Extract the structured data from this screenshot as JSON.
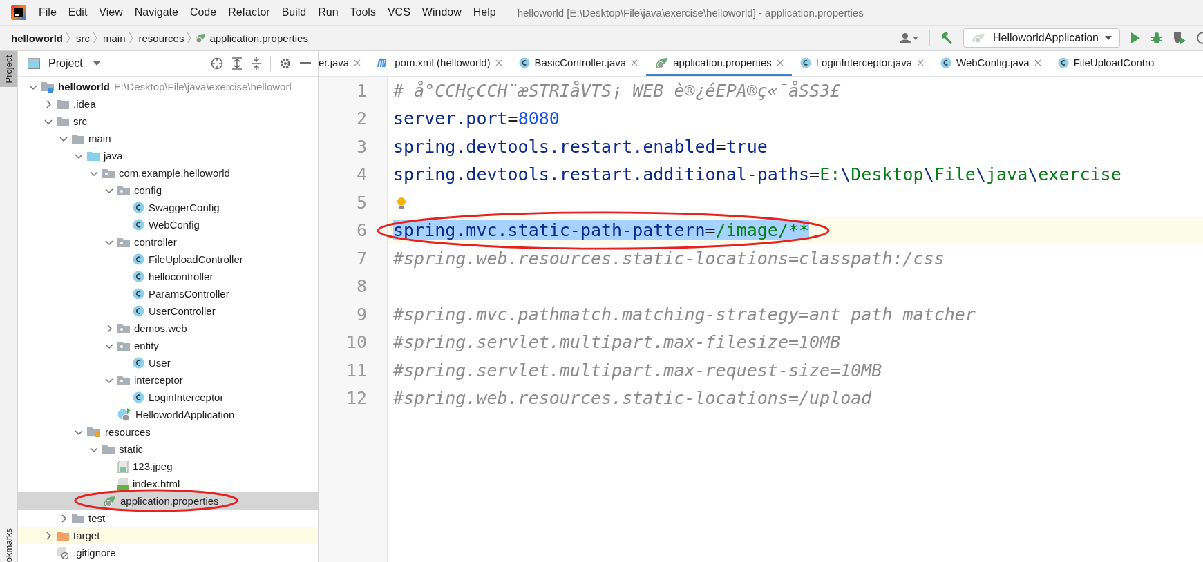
{
  "window": {
    "title": "helloworld [E:\\Desktop\\File\\java\\exercise\\helloworld] - application.properties"
  },
  "menu": [
    "File",
    "Edit",
    "View",
    "Navigate",
    "Code",
    "Refactor",
    "Build",
    "Run",
    "Tools",
    "VCS",
    "Window",
    "Help"
  ],
  "breadcrumbs": [
    {
      "label": "helloworld",
      "kind": "project"
    },
    {
      "label": "src",
      "kind": "folder"
    },
    {
      "label": "main",
      "kind": "folder"
    },
    {
      "label": "resources",
      "kind": "folder"
    },
    {
      "label": "application.properties",
      "kind": "properties"
    }
  ],
  "run_config": "HelloworldApplication",
  "side_stripe": [
    {
      "label": "Project",
      "selected": true
    },
    {
      "label": "okmarks",
      "selected": false
    }
  ],
  "project_panel": {
    "title": "Project",
    "tree": [
      {
        "label": "helloworld",
        "hint": "E:\\Desktop\\File\\java\\exercise\\helloworl",
        "kind": "module",
        "expanded": true,
        "selected": false,
        "children": [
          {
            "label": ".idea",
            "kind": "folder",
            "expanded": false,
            "selected": false
          },
          {
            "label": "src",
            "kind": "folder",
            "expanded": true,
            "selected": false,
            "children": [
              {
                "label": "main",
                "kind": "folder",
                "expanded": true,
                "selected": false,
                "children": [
                  {
                    "label": "java",
                    "kind": "source-folder",
                    "expanded": true,
                    "selected": false,
                    "children": [
                      {
                        "label": "com.example.helloworld",
                        "kind": "package",
                        "expanded": true,
                        "selected": false,
                        "children": [
                          {
                            "label": "config",
                            "kind": "package",
                            "expanded": true,
                            "selected": false,
                            "children": [
                              {
                                "label": "SwaggerConfig",
                                "kind": "class",
                                "selected": false
                              },
                              {
                                "label": "WebConfig",
                                "kind": "class",
                                "selected": false
                              }
                            ]
                          },
                          {
                            "label": "controller",
                            "kind": "package",
                            "expanded": true,
                            "selected": false,
                            "children": [
                              {
                                "label": "FileUploadController",
                                "kind": "class",
                                "selected": false
                              },
                              {
                                "label": "hellocontroller",
                                "kind": "class",
                                "selected": false
                              },
                              {
                                "label": "ParamsController",
                                "kind": "class",
                                "selected": false
                              },
                              {
                                "label": "UserController",
                                "kind": "class",
                                "selected": false
                              }
                            ]
                          },
                          {
                            "label": "demos.web",
                            "kind": "package",
                            "expanded": false,
                            "selected": false
                          },
                          {
                            "label": "entity",
                            "kind": "package",
                            "expanded": true,
                            "selected": false,
                            "children": [
                              {
                                "label": "User",
                                "kind": "class",
                                "selected": false
                              }
                            ]
                          },
                          {
                            "label": "interceptor",
                            "kind": "package",
                            "expanded": true,
                            "selected": false,
                            "children": [
                              {
                                "label": "LoginInterceptor",
                                "kind": "class",
                                "selected": false
                              }
                            ]
                          },
                          {
                            "label": "HelloworldApplication",
                            "kind": "spring-app",
                            "selected": false
                          }
                        ]
                      }
                    ]
                  },
                  {
                    "label": "resources",
                    "kind": "resources",
                    "expanded": true,
                    "selected": false,
                    "children": [
                      {
                        "label": "static",
                        "kind": "folder",
                        "expanded": true,
                        "selected": false,
                        "children": [
                          {
                            "label": "123.jpeg",
                            "kind": "image-file",
                            "selected": false
                          },
                          {
                            "label": "index.html",
                            "kind": "html-file",
                            "selected": false
                          }
                        ]
                      },
                      {
                        "label": "application.properties",
                        "kind": "properties",
                        "selected": true,
                        "circled": true
                      }
                    ]
                  }
                ]
              },
              {
                "label": "test",
                "kind": "folder",
                "expanded": false,
                "selected": false
              }
            ]
          },
          {
            "label": "target",
            "kind": "excluded-folder",
            "expanded": false,
            "selected": false
          },
          {
            "label": ".gitignore",
            "kind": "ignore-file",
            "selected": false
          }
        ]
      }
    ]
  },
  "tabs": [
    {
      "label": "er.java",
      "kind": "plain",
      "selected": false
    },
    {
      "label": "pom.xml (helloworld)",
      "kind": "maven",
      "selected": false
    },
    {
      "label": "BasicController.java",
      "kind": "class",
      "selected": false
    },
    {
      "label": "application.properties",
      "kind": "properties",
      "selected": true
    },
    {
      "label": "LoginInterceptor.java",
      "kind": "class",
      "selected": false
    },
    {
      "label": "WebConfig.java",
      "kind": "class",
      "selected": false
    },
    {
      "label": "FileUploadContro",
      "kind": "class",
      "selected": false,
      "cut": true
    }
  ],
  "editor": {
    "lines": [
      {
        "number": "1",
        "selected": false,
        "segments": [
          {
            "text": "# å°CCHçCCH¨æSTRIåVTS¡ WEB è®¿éEPA®ç«¯åSS3£",
            "kind": "comment"
          }
        ]
      },
      {
        "number": "2",
        "selected": false,
        "segments": [
          {
            "text": "server.port",
            "kind": "key"
          },
          {
            "text": "=",
            "kind": "op"
          },
          {
            "text": "8080",
            "kind": "number"
          }
        ]
      },
      {
        "number": "3",
        "selected": false,
        "segments": [
          {
            "text": "spring.devtools.restart.enabled",
            "kind": "key"
          },
          {
            "text": "=",
            "kind": "op"
          },
          {
            "text": "true",
            "kind": "key"
          }
        ]
      },
      {
        "number": "4",
        "selected": false,
        "segments": [
          {
            "text": "spring.devtools.restart.additional-paths",
            "kind": "key"
          },
          {
            "text": "=",
            "kind": "op"
          },
          {
            "text": "E:",
            "kind": "value"
          },
          {
            "text": "\\",
            "kind": "key"
          },
          {
            "text": "Desktop",
            "kind": "value"
          },
          {
            "text": "\\",
            "kind": "key"
          },
          {
            "text": "File",
            "kind": "value"
          },
          {
            "text": "\\",
            "kind": "key"
          },
          {
            "text": "java",
            "kind": "value"
          },
          {
            "text": "\\",
            "kind": "key"
          },
          {
            "text": "exercise",
            "kind": "value"
          }
        ]
      },
      {
        "number": "5",
        "selected": false,
        "intention": true
      },
      {
        "number": "6",
        "selected": true,
        "circled": true,
        "segments": [
          {
            "text": "spring.mvc.static-path-pattern",
            "kind": "key"
          },
          {
            "text": "=",
            "kind": "op"
          },
          {
            "text": "/image/**",
            "kind": "value"
          }
        ]
      },
      {
        "number": "7",
        "selected": false,
        "segments": [
          {
            "text": "#spring.web.resources.static-locations=classpath:/css",
            "kind": "comment"
          }
        ]
      },
      {
        "number": "8",
        "selected": false
      },
      {
        "number": "9",
        "selected": false,
        "segments": [
          {
            "text": "#spring.mvc.pathmatch.matching-strategy=ant_path_matcher",
            "kind": "comment"
          }
        ]
      },
      {
        "number": "10",
        "selected": false,
        "segments": [
          {
            "text": "#spring.servlet.multipart.max-filesize=10MB",
            "kind": "comment"
          }
        ]
      },
      {
        "number": "11",
        "selected": false,
        "segments": [
          {
            "text": "#spring.servlet.multipart.max-request-size=10MB",
            "kind": "comment"
          }
        ]
      },
      {
        "number": "12",
        "selected": false,
        "segments": [
          {
            "text": "#spring.web.resources.static-locations=/upload",
            "kind": "comment"
          }
        ]
      }
    ]
  }
}
